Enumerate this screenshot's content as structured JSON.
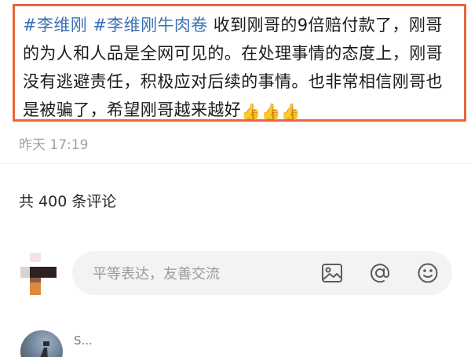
{
  "post": {
    "hashtags": [
      "#李维刚",
      "#李维刚牛肉卷"
    ],
    "text": "收到刚哥的9倍赔付款了，刚哥的为人和人品是全网可见的。在处理事情的态度上，刚哥没有逃避责任，积极应对后续的事情。也非常相信刚哥也是被骗了，希望刚哥越来越好",
    "emoji": "👍👍👍",
    "timestamp": "昨天 17:19"
  },
  "comments": {
    "count_label": "共 400 条评论",
    "input": {
      "placeholder": "平等表达，友善交流",
      "icons": [
        "image-icon",
        "at-icon",
        "emoji-icon"
      ]
    },
    "items": [
      {
        "username": "S..."
      }
    ]
  },
  "colors": {
    "hashtag": "#3a6fb3",
    "highlight_border": "#e8663c",
    "input_bg": "#f3f3f4",
    "timestamp": "#a0a0a0"
  }
}
